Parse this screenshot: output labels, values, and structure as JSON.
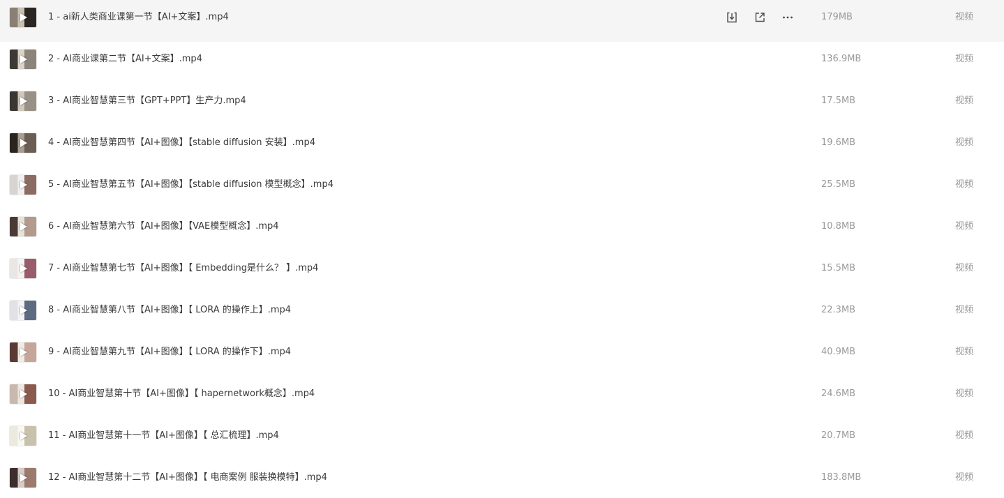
{
  "files": [
    {
      "name": "1 - ai新人类商业课第一节【AI+文案】.mp4",
      "size": "179MB",
      "type": "视频",
      "thumb": [
        "#8a7f74",
        "#2b2622",
        "#c9c0b4"
      ],
      "hover": true
    },
    {
      "name": "2 - AI商业课第二节【AI+文案】.mp4",
      "size": "136.9MB",
      "type": "视频",
      "thumb": [
        "#3d3935",
        "#8c8479",
        "#d9d3ca"
      ]
    },
    {
      "name": "3 - AI商业智慧第三节【GPT+PPT】生产力.mp4",
      "size": "17.5MB",
      "type": "视频",
      "thumb": [
        "#3a3632",
        "#9a9186",
        "#cfc7bb"
      ]
    },
    {
      "name": "4 - AI商业智慧第四节【AI+图像】【stable diffusion 安装】.mp4",
      "size": "19.6MB",
      "type": "视频",
      "thumb": [
        "#2a2420",
        "#6b5f55",
        "#a89d90"
      ]
    },
    {
      "name": "5 - AI商业智慧第五节【AI+图像】【stable diffusion 模型概念】.mp4",
      "size": "25.5MB",
      "type": "视频",
      "thumb": [
        "#d7d4d2",
        "#8b6b62",
        "#f2f0ee"
      ]
    },
    {
      "name": "6 - AI商业智慧第六节【AI+图像】【VAE模型概念】.mp4",
      "size": "10.8MB",
      "type": "视频",
      "thumb": [
        "#4a3a36",
        "#b39a8c",
        "#e8e2dc"
      ]
    },
    {
      "name": "7 - AI商业智慧第七节【AI+图像】【 Embedding是什么？ 】.mp4",
      "size": "15.5MB",
      "type": "视频",
      "thumb": [
        "#e9e6e4",
        "#9a5c6a",
        "#f6f4f2"
      ]
    },
    {
      "name": "8 - AI商业智慧第八节【AI+图像】【 LORA 的操作上】.mp4",
      "size": "22.3MB",
      "type": "视频",
      "thumb": [
        "#e2e2e4",
        "#5d6b82",
        "#f3f3f5"
      ]
    },
    {
      "name": "9 - AI商业智慧第九节【AI+图像】【 LORA 的操作下】.mp4",
      "size": "40.9MB",
      "type": "视频",
      "thumb": [
        "#5a3a34",
        "#c7a69a",
        "#f0ebe7"
      ]
    },
    {
      "name": "10 - AI商业智慧第十节【AI+图像】【 hapernetwork概念】.mp4",
      "size": "24.6MB",
      "type": "视频",
      "thumb": [
        "#c9b8ae",
        "#8a5a4e",
        "#ede6e1"
      ]
    },
    {
      "name": "11 - AI商业智慧第十一节【AI+图像】【 总汇梳理】.mp4",
      "size": "20.7MB",
      "type": "视频",
      "thumb": [
        "#ece9df",
        "#c8c2ad",
        "#faf8f2"
      ]
    },
    {
      "name": "12 - AI商业智慧第十二节【AI+图像】【 电商案例 服装换模特】.mp4",
      "size": "183.8MB",
      "type": "视频",
      "thumb": [
        "#3b2e2c",
        "#9c7a6e",
        "#d8ccc6"
      ]
    }
  ],
  "actions": {
    "download_icon": "download-icon",
    "share_icon": "share-icon",
    "more_icon": "more-icon"
  },
  "colors": {
    "hover_bg": "#f5f5f6",
    "text": "#3a3a3a",
    "muted": "#9a9a9a"
  }
}
